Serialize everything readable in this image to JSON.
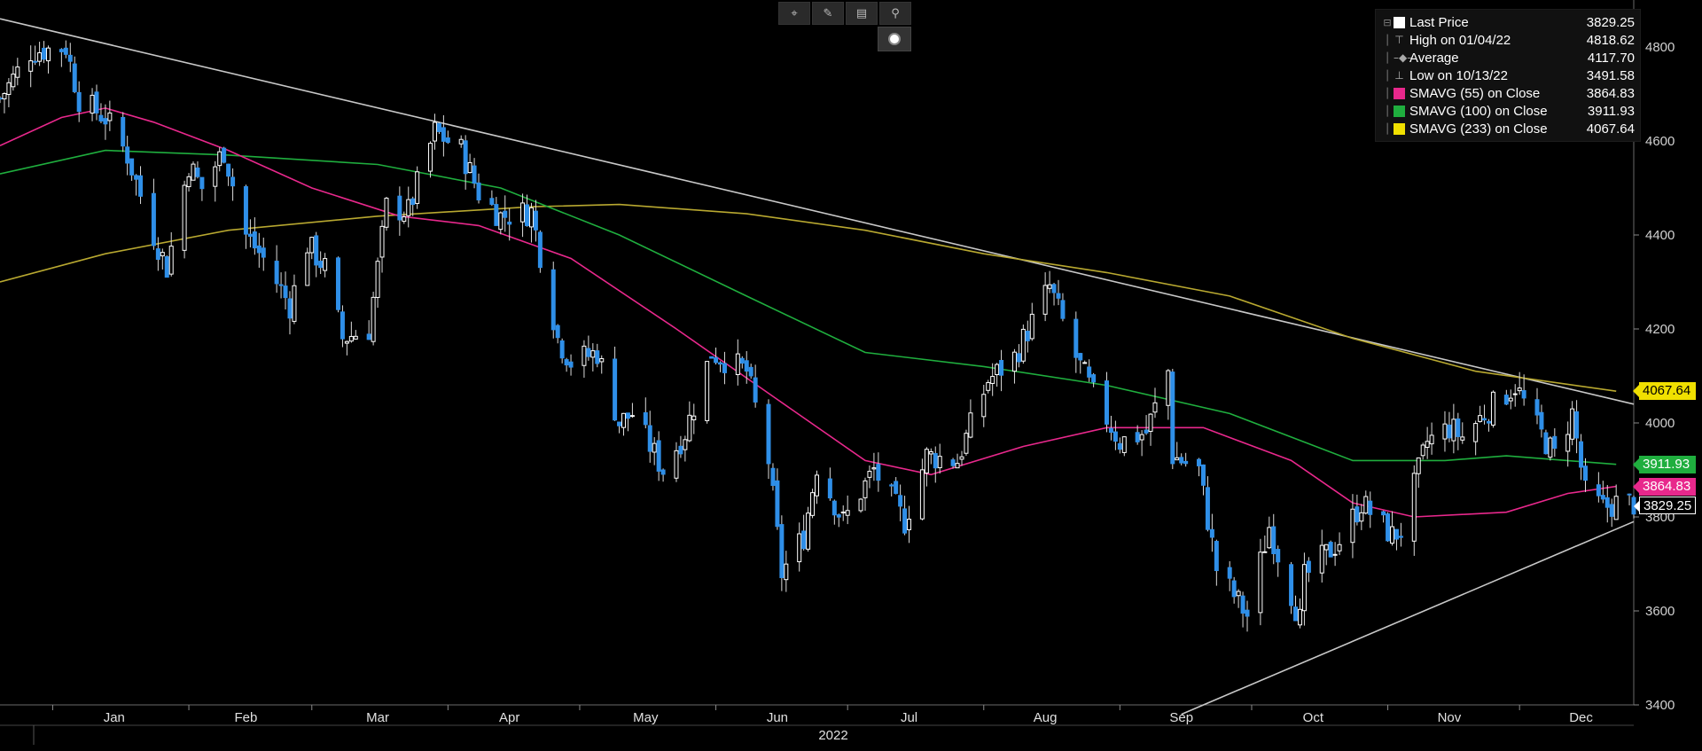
{
  "toolbar": {
    "icons": [
      "crosshair-icon",
      "draw-icon",
      "table-icon",
      "zoom-icon"
    ],
    "glyphs": [
      "⌖",
      "✎",
      "▤",
      "⚲"
    ]
  },
  "legend": {
    "items": [
      {
        "label": "Last Price",
        "value": "3829.25",
        "swatch": "#ffffff",
        "glyph": ""
      },
      {
        "label": "High on 01/04/22",
        "value": "4818.62",
        "swatch": "",
        "glyph": "⊤"
      },
      {
        "label": "Average",
        "value": "4117.70",
        "swatch": "",
        "glyph": "–◆–"
      },
      {
        "label": "Low on 10/13/22",
        "value": "3491.58",
        "swatch": "",
        "glyph": "⊥"
      },
      {
        "label": "SMAVG (55)  on Close",
        "value": "3864.83",
        "swatch": "#e8288c",
        "glyph": ""
      },
      {
        "label": "SMAVG (100)  on Close",
        "value": "3911.93",
        "swatch": "#1fae3e",
        "glyph": ""
      },
      {
        "label": "SMAVG (233)  on Close",
        "value": "4067.64",
        "swatch": "#f0e000",
        "glyph": ""
      }
    ]
  },
  "badges": [
    {
      "label": "4067.64",
      "value": 4067.64,
      "bg": "#f0e000",
      "fg": "#000000"
    },
    {
      "label": "3911.93",
      "value": 3911.93,
      "bg": "#1fae3e",
      "fg": "#ffffff"
    },
    {
      "label": "3864.83",
      "value": 3864.83,
      "bg": "#e8288c",
      "fg": "#ffffff"
    },
    {
      "label": "3829.25",
      "value": 3829.25,
      "bg": "#000000",
      "fg": "#ffffff"
    }
  ],
  "chart_data": {
    "type": "candlestick",
    "title": "",
    "xlabel": "2022",
    "ylabel": "",
    "ylim": [
      3400,
      4900
    ],
    "yticks": [
      3400,
      3600,
      3800,
      4000,
      4200,
      4400,
      4600,
      4800
    ],
    "x_start": "2021-12-20",
    "x_end": "2022-12-27",
    "grid": false,
    "legend_position": "top-right",
    "colors": {
      "up": "#ffffff",
      "down": "#2f8fe8",
      "sma55": "#e8288c",
      "sma100": "#1fae3e",
      "sma233": "#b8a830",
      "trendline": "#c8c8c8"
    },
    "month_labels": [
      {
        "label": "Jan",
        "date": "2022-01-15"
      },
      {
        "label": "Feb",
        "date": "2022-02-14"
      },
      {
        "label": "Mar",
        "date": "2022-03-16"
      },
      {
        "label": "Apr",
        "date": "2022-04-15"
      },
      {
        "label": "May",
        "date": "2022-05-16"
      },
      {
        "label": "Jun",
        "date": "2022-06-15"
      },
      {
        "label": "Jul",
        "date": "2022-07-15"
      },
      {
        "label": "Aug",
        "date": "2022-08-15"
      },
      {
        "label": "Sep",
        "date": "2022-09-15"
      },
      {
        "label": "Oct",
        "date": "2022-10-15"
      },
      {
        "label": "Nov",
        "date": "2022-11-15"
      },
      {
        "label": "Dec",
        "date": "2022-12-15"
      }
    ],
    "month_starts": [
      "2022-01-01",
      "2022-02-01",
      "2022-03-01",
      "2022-04-01",
      "2022-05-01",
      "2022-06-01",
      "2022-07-01",
      "2022-08-01",
      "2022-09-01",
      "2022-10-01",
      "2022-11-01",
      "2022-12-01"
    ],
    "close_path": [
      [
        "2021-12-20",
        4690
      ],
      [
        "2021-12-27",
        4790
      ],
      [
        "2022-01-04",
        4800
      ],
      [
        "2022-01-07",
        4690
      ],
      [
        "2022-01-13",
        4650
      ],
      [
        "2022-01-18",
        4570
      ],
      [
        "2022-01-24",
        4400
      ],
      [
        "2022-01-27",
        4330
      ],
      [
        "2022-02-01",
        4550
      ],
      [
        "2022-02-04",
        4500
      ],
      [
        "2022-02-09",
        4580
      ],
      [
        "2022-02-14",
        4400
      ],
      [
        "2022-02-18",
        4350
      ],
      [
        "2022-02-24",
        4250
      ],
      [
        "2022-02-28",
        4380
      ],
      [
        "2022-03-04",
        4330
      ],
      [
        "2022-03-08",
        4180
      ],
      [
        "2022-03-14",
        4200
      ],
      [
        "2022-03-18",
        4460
      ],
      [
        "2022-03-23",
        4450
      ],
      [
        "2022-03-29",
        4620
      ],
      [
        "2022-04-04",
        4580
      ],
      [
        "2022-04-08",
        4490
      ],
      [
        "2022-04-13",
        4440
      ],
      [
        "2022-04-20",
        4450
      ],
      [
        "2022-04-26",
        4180
      ],
      [
        "2022-04-29",
        4130
      ],
      [
        "2022-05-05",
        4150
      ],
      [
        "2022-05-10",
        4000
      ],
      [
        "2022-05-13",
        4020
      ],
      [
        "2022-05-20",
        3900
      ],
      [
        "2022-05-25",
        3980
      ],
      [
        "2022-05-31",
        4150
      ],
      [
        "2022-06-08",
        4110
      ],
      [
        "2022-06-13",
        3920
      ],
      [
        "2022-06-16",
        3680
      ],
      [
        "2022-06-21",
        3760
      ],
      [
        "2022-06-24",
        3910
      ],
      [
        "2022-06-30",
        3790
      ],
      [
        "2022-07-07",
        3900
      ],
      [
        "2022-07-14",
        3790
      ],
      [
        "2022-07-19",
        3930
      ],
      [
        "2022-07-26",
        3920
      ],
      [
        "2022-08-02",
        4090
      ],
      [
        "2022-08-08",
        4140
      ],
      [
        "2022-08-16",
        4290
      ],
      [
        "2022-08-22",
        4140
      ],
      [
        "2022-08-26",
        4060
      ],
      [
        "2022-09-01",
        3960
      ],
      [
        "2022-09-07",
        3980
      ],
      [
        "2022-09-12",
        4110
      ],
      [
        "2022-09-13",
        3930
      ],
      [
        "2022-09-19",
        3900
      ],
      [
        "2022-09-23",
        3690
      ],
      [
        "2022-09-30",
        3590
      ],
      [
        "2022-10-05",
        3780
      ],
      [
        "2022-10-12",
        3580
      ],
      [
        "2022-10-13",
        3670
      ],
      [
        "2022-10-18",
        3720
      ],
      [
        "2022-10-21",
        3750
      ],
      [
        "2022-10-26",
        3830
      ],
      [
        "2022-11-02",
        3760
      ],
      [
        "2022-11-04",
        3770
      ],
      [
        "2022-11-10",
        3960
      ],
      [
        "2022-11-15",
        3990
      ],
      [
        "2022-11-18",
        3970
      ],
      [
        "2022-11-23",
        4020
      ],
      [
        "2022-11-30",
        4080
      ],
      [
        "2022-12-05",
        3990
      ],
      [
        "2022-12-09",
        3930
      ],
      [
        "2022-12-13",
        4020
      ],
      [
        "2022-12-16",
        3850
      ],
      [
        "2022-12-20",
        3820
      ],
      [
        "2022-12-23",
        3829.25
      ]
    ],
    "sma55": [
      [
        "2021-12-20",
        4590
      ],
      [
        "2022-01-03",
        4650
      ],
      [
        "2022-01-13",
        4670
      ],
      [
        "2022-01-24",
        4640
      ],
      [
        "2022-02-10",
        4580
      ],
      [
        "2022-03-01",
        4500
      ],
      [
        "2022-03-21",
        4440
      ],
      [
        "2022-04-08",
        4420
      ],
      [
        "2022-04-29",
        4350
      ],
      [
        "2022-05-23",
        4200
      ],
      [
        "2022-06-15",
        4050
      ],
      [
        "2022-07-05",
        3920
      ],
      [
        "2022-07-20",
        3890
      ],
      [
        "2022-08-10",
        3950
      ],
      [
        "2022-08-29",
        3990
      ],
      [
        "2022-09-20",
        3990
      ],
      [
        "2022-10-10",
        3920
      ],
      [
        "2022-10-24",
        3830
      ],
      [
        "2022-11-07",
        3800
      ],
      [
        "2022-11-28",
        3810
      ],
      [
        "2022-12-12",
        3850
      ],
      [
        "2022-12-23",
        3864.83
      ]
    ],
    "sma100": [
      [
        "2021-12-20",
        4530
      ],
      [
        "2022-01-13",
        4580
      ],
      [
        "2022-02-10",
        4570
      ],
      [
        "2022-03-16",
        4550
      ],
      [
        "2022-04-13",
        4500
      ],
      [
        "2022-05-10",
        4400
      ],
      [
        "2022-06-08",
        4270
      ],
      [
        "2022-07-05",
        4150
      ],
      [
        "2022-08-01",
        4120
      ],
      [
        "2022-08-29",
        4080
      ],
      [
        "2022-09-26",
        4020
      ],
      [
        "2022-10-24",
        3920
      ],
      [
        "2022-11-14",
        3920
      ],
      [
        "2022-11-28",
        3930
      ],
      [
        "2022-12-23",
        3911.93
      ]
    ],
    "sma233": [
      [
        "2021-12-20",
        4300
      ],
      [
        "2022-01-13",
        4360
      ],
      [
        "2022-02-10",
        4410
      ],
      [
        "2022-03-16",
        4440
      ],
      [
        "2022-04-20",
        4460
      ],
      [
        "2022-05-10",
        4465
      ],
      [
        "2022-06-08",
        4445
      ],
      [
        "2022-07-05",
        4410
      ],
      [
        "2022-08-01",
        4360
      ],
      [
        "2022-08-29",
        4320
      ],
      [
        "2022-09-26",
        4270
      ],
      [
        "2022-10-24",
        4180
      ],
      [
        "2022-11-21",
        4110
      ],
      [
        "2022-12-23",
        4067.64
      ]
    ],
    "trendlines": [
      {
        "from": [
          "2021-12-20",
          4860
        ],
        "to": [
          "2022-12-27",
          4040
        ]
      },
      {
        "from": [
          "2022-09-15",
          3380
        ],
        "to": [
          "2022-12-27",
          3790
        ]
      }
    ]
  }
}
